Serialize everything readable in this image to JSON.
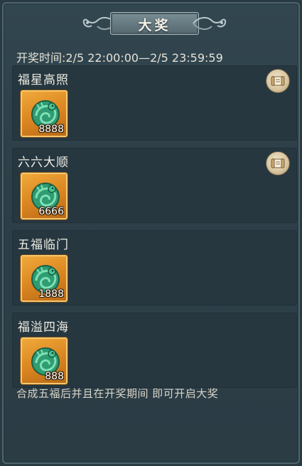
{
  "title": "大奖",
  "draw_time": "开奖时间:2/5 22:00:00—2/5 23:59:59",
  "prizes": [
    {
      "name": "福星高照",
      "count": "8888",
      "has_scroll": true
    },
    {
      "name": "六六大顺",
      "count": "6666",
      "has_scroll": true
    },
    {
      "name": "五福临门",
      "count": "1888",
      "has_scroll": false
    },
    {
      "name": "福溢四海",
      "count": "888",
      "has_scroll": false
    }
  ],
  "footer_note": "合成五福后并且在开奖期间 即可开启大奖",
  "colors": {
    "panel_bg": "#2d3f48",
    "card_bg": "#263740",
    "item_slot": "#e0901f",
    "jade": "#3fb98a"
  },
  "icons": {
    "scroll": "scroll-icon",
    "item": "jade-dragon-icon"
  }
}
